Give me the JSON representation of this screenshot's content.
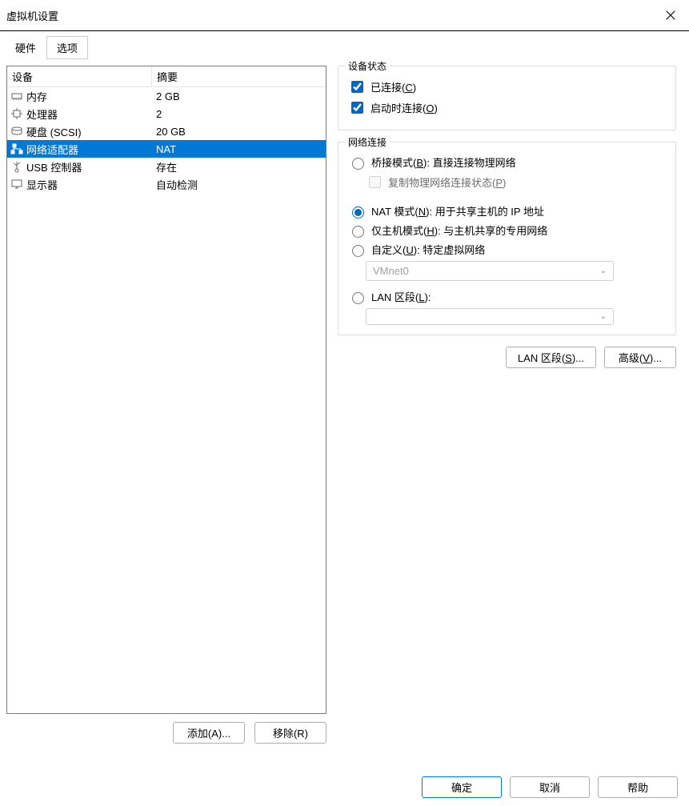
{
  "window": {
    "title": "虚拟机设置"
  },
  "tabs": {
    "hardware": "硬件",
    "options": "选项"
  },
  "table": {
    "header_device": "设备",
    "header_summary": "摘要",
    "rows": [
      {
        "name": "内存",
        "summary": "2 GB",
        "icon": "memory"
      },
      {
        "name": "处理器",
        "summary": "2",
        "icon": "cpu"
      },
      {
        "name": "硬盘 (SCSI)",
        "summary": "20 GB",
        "icon": "disk"
      },
      {
        "name": "网络适配器",
        "summary": "NAT",
        "icon": "network"
      },
      {
        "name": "USB 控制器",
        "summary": "存在",
        "icon": "usb"
      },
      {
        "name": "显示器",
        "summary": "自动检测",
        "icon": "display"
      }
    ]
  },
  "left_buttons": {
    "add": "添加(A)...",
    "remove": "移除(R)"
  },
  "status_group": {
    "legend": "设备状态",
    "connected_prefix": "已连接(",
    "connected_key": "C",
    "connected_suffix": ")",
    "connect_at_poweron_prefix": "启动时连接(",
    "connect_at_poweron_key": "O",
    "connect_at_poweron_suffix": ")"
  },
  "net_group": {
    "legend": "网络连接",
    "bridged_prefix": "桥接模式(",
    "bridged_key": "B",
    "bridged_suffix": "): 直接连接物理网络",
    "replicate_prefix": "复制物理网络连接状态(",
    "replicate_key": "P",
    "replicate_suffix": ")",
    "nat_prefix": "NAT 模式(",
    "nat_key": "N",
    "nat_suffix": "): 用于共享主机的 IP 地址",
    "hostonly_prefix": "仅主机模式(",
    "hostonly_key": "H",
    "hostonly_suffix": "): 与主机共享的专用网络",
    "custom_prefix": "自定义(",
    "custom_key": "U",
    "custom_suffix": "): 特定虚拟网络",
    "custom_value": "VMnet0",
    "lanseg_prefix": "LAN 区段(",
    "lanseg_key": "L",
    "lanseg_suffix": "):"
  },
  "right_buttons": {
    "lan_prefix": "LAN 区段(",
    "lan_key": "S",
    "lan_suffix": ")...",
    "adv_prefix": "高级(",
    "adv_key": "V",
    "adv_suffix": ")..."
  },
  "footer": {
    "ok": "确定",
    "cancel": "取消",
    "help": "帮助"
  }
}
